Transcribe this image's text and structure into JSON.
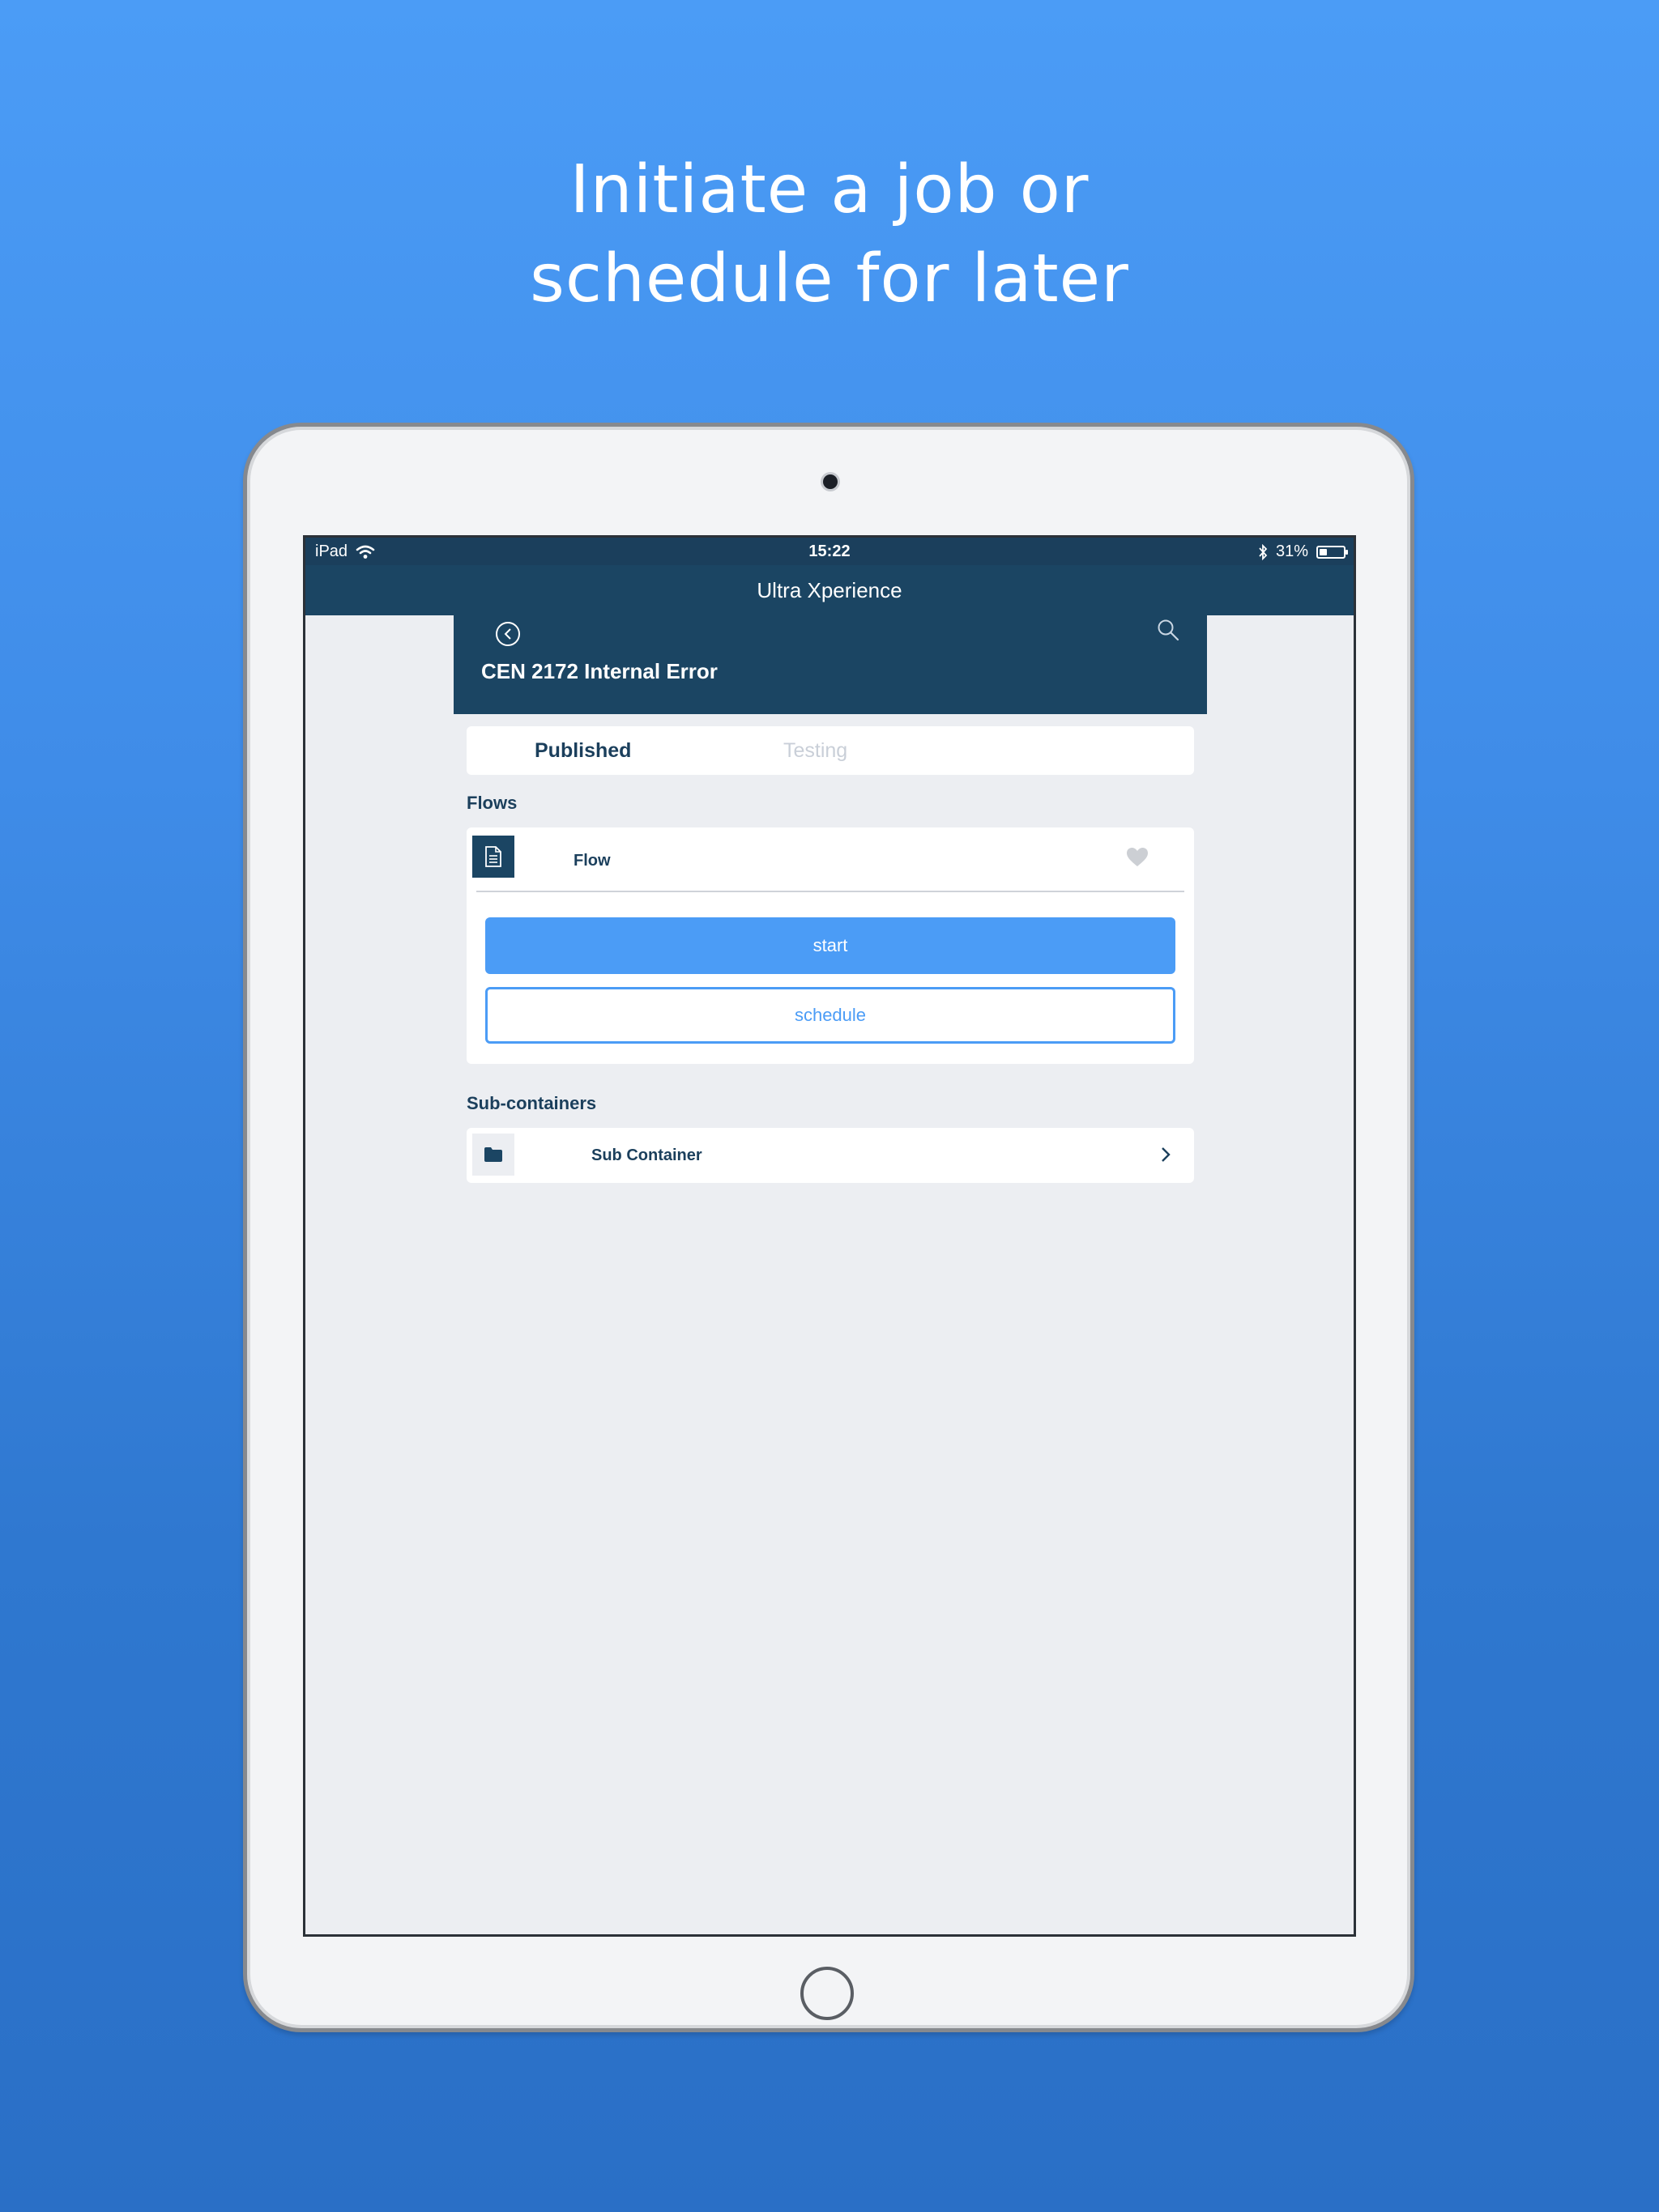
{
  "headline": {
    "line1": "Initiate a job or",
    "line2": "schedule for later"
  },
  "status_bar": {
    "device": "iPad",
    "time": "15:22",
    "battery_text": "31%",
    "battery_level": 0.31
  },
  "nav": {
    "title": "Ultra Xperience"
  },
  "detail": {
    "title": "CEN 2172 Internal Error"
  },
  "tabs": [
    {
      "label": "Published",
      "active": true
    },
    {
      "label": "Testing",
      "active": false
    }
  ],
  "flows": {
    "section_label": "Flows",
    "items": [
      {
        "name": "Flow",
        "icon": "document-icon",
        "favorite": false
      }
    ],
    "start_label": "start",
    "schedule_label": "schedule"
  },
  "subcontainers": {
    "section_label": "Sub-containers",
    "items": [
      {
        "name": "Sub Container",
        "icon": "folder-icon"
      }
    ]
  },
  "colors": {
    "accent": "#4b9cf6",
    "header": "#1b4563",
    "text_dark": "#1b3f5c",
    "inactive_tab": "#c9cfd8"
  }
}
